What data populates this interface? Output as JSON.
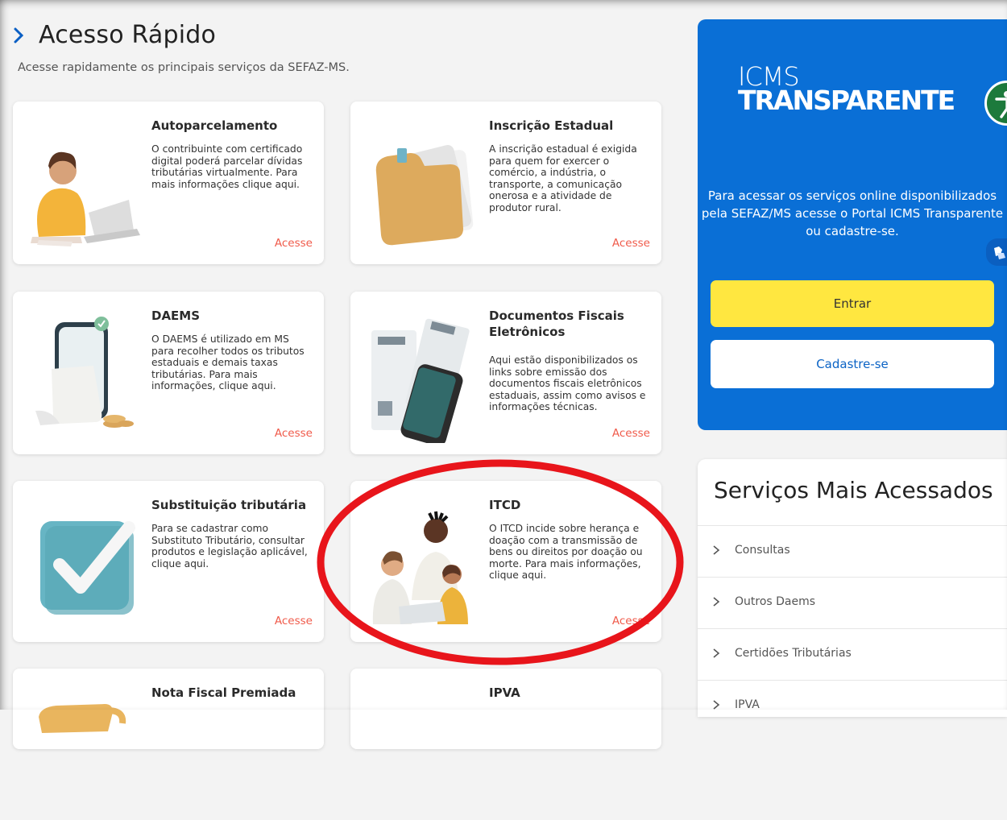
{
  "header": {
    "title": "Acesso Rápido",
    "subtitle": "Acesse rapidamente os principais serviços da SEFAZ-MS."
  },
  "cards": [
    {
      "title": "Autoparcelamento",
      "description": "O contribuinte com certificado digital poderá parcelar dívidas tributárias virtualmente. Para mais informações clique aqui.",
      "link": "Acesse"
    },
    {
      "title": "Inscrição Estadual",
      "description": "A inscrição estadual é exigida para quem for exercer o comércio, a indústria, o transporte, a comunicação onerosa e a atividade de produtor rural.",
      "link": "Acesse"
    },
    {
      "title": "DAEMS",
      "description": "O DAEMS é utilizado em MS para recolher todos os tributos estaduais e demais taxas tributárias. Para mais informações, clique aqui.",
      "link": "Acesse"
    },
    {
      "title": "Documentos Fiscais Eletrônicos",
      "description": "Aqui estão disponibilizados os links sobre emissão dos documentos fiscais eletrônicos estaduais, assim como avisos e informações técnicas.",
      "link": "Acesse"
    },
    {
      "title": "Substituição tributária",
      "description": "Para se cadastrar como Substituto Tributário, consultar produtos e legislação aplicável, clique aqui.",
      "link": "Acesse"
    },
    {
      "title": "ITCD",
      "description": "O ITCD incide sobre herança e doação com a transmissão de bens ou direitos por doação ou morte. Para mais informações, clique aqui.",
      "link": "Acesse"
    },
    {
      "title": "Nota Fiscal Premiada"
    },
    {
      "title": "IPVA"
    }
  ],
  "portal": {
    "logo_line1": "ICMS",
    "logo_line2": "TRANSPARENTE",
    "text": "Para acessar os serviços online disponibilizados pela SEFAZ/MS acesse o Portal ICMS Transparente ou cadastre-se.",
    "login_button": "Entrar",
    "register_button": "Cadastre-se"
  },
  "services": {
    "title": "Serviços Mais Acessados",
    "items": [
      "Consultas",
      "Outros Daems",
      "Certidões Tributárias",
      "IPVA"
    ]
  },
  "colors": {
    "brand_blue": "#0a6fd6",
    "accent_yellow": "#ffe740",
    "link_red": "#f05b4b",
    "annotation_red": "#e8151b"
  }
}
